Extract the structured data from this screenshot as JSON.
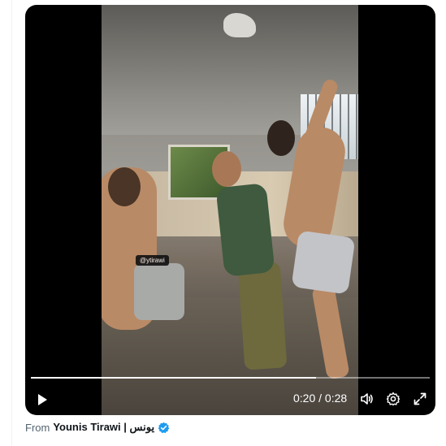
{
  "video": {
    "watermark": "@ytirawi",
    "time_current": "0:20",
    "time_separator": "/",
    "time_total": "0:28",
    "progress": 0.714
  },
  "controls": {
    "play_icon": "play-icon",
    "volume_icon": "volume-icon",
    "settings_icon": "gear-icon",
    "fullscreen_icon": "fullscreen-icon"
  },
  "attribution": {
    "prefix": "From",
    "name": "Younis Tirawi | يونس",
    "verified_color": "#1d9bf0"
  },
  "colors": {
    "player_bg": "#000000",
    "text_muted": "#536471",
    "text_primary": "#0f1419"
  }
}
